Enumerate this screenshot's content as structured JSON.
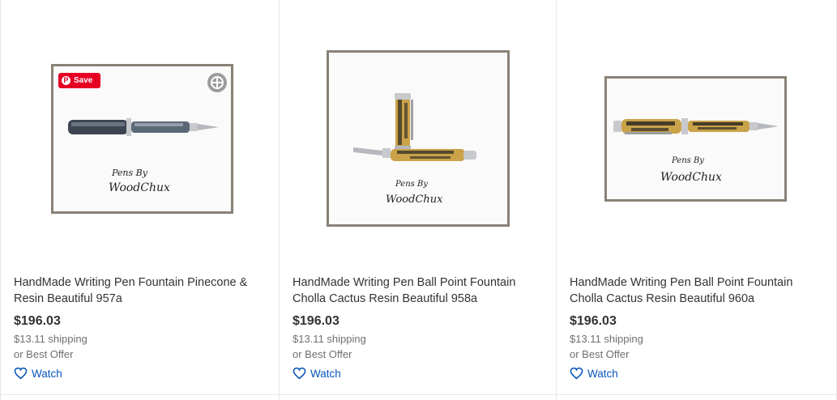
{
  "listings": [
    {
      "title": "HandMade Writing Pen Fountain Pinecone & Resin Beautiful 957a",
      "price": "$196.03",
      "shipping": "$13.11 shipping",
      "offer": "or Best Offer",
      "watch_label": "Watch",
      "image_text_top": "Pens By",
      "image_text_brand": "WoodChux"
    },
    {
      "title": "HandMade Writing Pen Ball Point Fountain Cholla Cactus Resin Beautiful 958a",
      "price": "$196.03",
      "shipping": "$13.11 shipping",
      "offer": "or Best Offer",
      "watch_label": "Watch",
      "image_text_top": "Pens By",
      "image_text_brand": "WoodChux"
    },
    {
      "title": "HandMade Writing Pen Ball Point Fountain Cholla Cactus Resin Beautiful 960a",
      "price": "$196.03",
      "shipping": "$13.11 shipping",
      "offer": "or Best Offer",
      "watch_label": "Watch",
      "image_text_top": "Pens By",
      "image_text_brand": "WoodChux"
    }
  ],
  "pinterest": {
    "save_label": "Save",
    "icon": "pinterest-icon"
  },
  "icons": {
    "watch": "heart-outline-icon",
    "zoom": "zoom-in-icon"
  },
  "colors": {
    "link": "#0654ba",
    "pinterest": "#e60023",
    "frame": "#8a8176"
  }
}
